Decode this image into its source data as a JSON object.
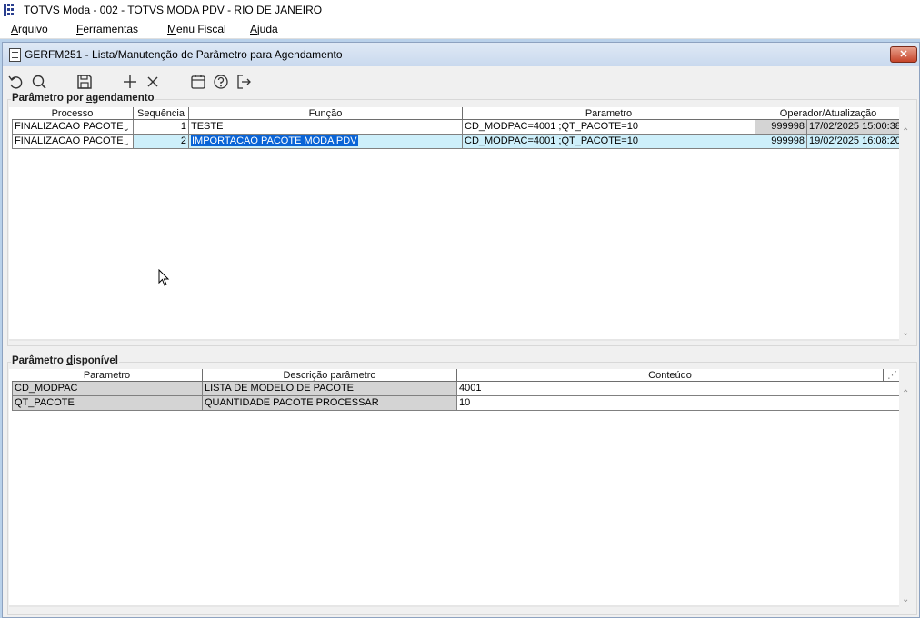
{
  "window": {
    "title": "TOTVS Moda - 002 - TOTVS MODA PDV - RIO DE JANEIRO"
  },
  "menu": [
    {
      "accel": "A",
      "rest": "rquivo"
    },
    {
      "accel": "F",
      "rest": "erramentas"
    },
    {
      "accel": "M",
      "rest": "enu Fiscal"
    },
    {
      "accel": "A",
      "rest": "juda"
    }
  ],
  "child": {
    "title": "GERFM251 - Lista/Manutenção de Parâmetro para Agendamento",
    "close": "✕"
  },
  "toolbar": {
    "icons": [
      "undo-icon",
      "search-icon",
      "save-icon",
      "add-icon",
      "delete-icon",
      "calendar-icon",
      "help-icon",
      "exit-icon"
    ]
  },
  "schedule": {
    "title_pre": "Parâmetro por ",
    "title_accel": "a",
    "title_post": "gendamento",
    "columns": [
      "Processo",
      "Sequência",
      "Função",
      "Parametro",
      "Operador/Atualização"
    ],
    "rows": [
      {
        "processo": "FINALIZACAO PACOTE",
        "sequencia": "1",
        "funcao": "TESTE",
        "parametro": "CD_MODPAC=4001 ;QT_PACOTE=10",
        "operador": "999998",
        "atualizacao": "17/02/2025 15:00:38"
      },
      {
        "processo": "FINALIZACAO PACOTE",
        "sequencia": "2",
        "funcao": "IMPORTACAO PACOTE MODA PDV",
        "parametro": "CD_MODPAC=4001 ;QT_PACOTE=10",
        "operador": "999998",
        "atualizacao": "19/02/2025 16:08:20"
      }
    ]
  },
  "available": {
    "title_pre": "Parâmetro ",
    "title_accel": "d",
    "title_post": "isponível",
    "columns": [
      "Parametro",
      "Descrição parâmetro",
      "Conteúdo"
    ],
    "rows": [
      {
        "parametro": "CD_MODPAC",
        "descricao": "LISTA DE MODELO DE PACOTE",
        "conteudo": "4001"
      },
      {
        "parametro": "QT_PACOTE",
        "descricao": "QUANTIDADE PACOTE PROCESSAR",
        "conteudo": "10"
      }
    ]
  }
}
